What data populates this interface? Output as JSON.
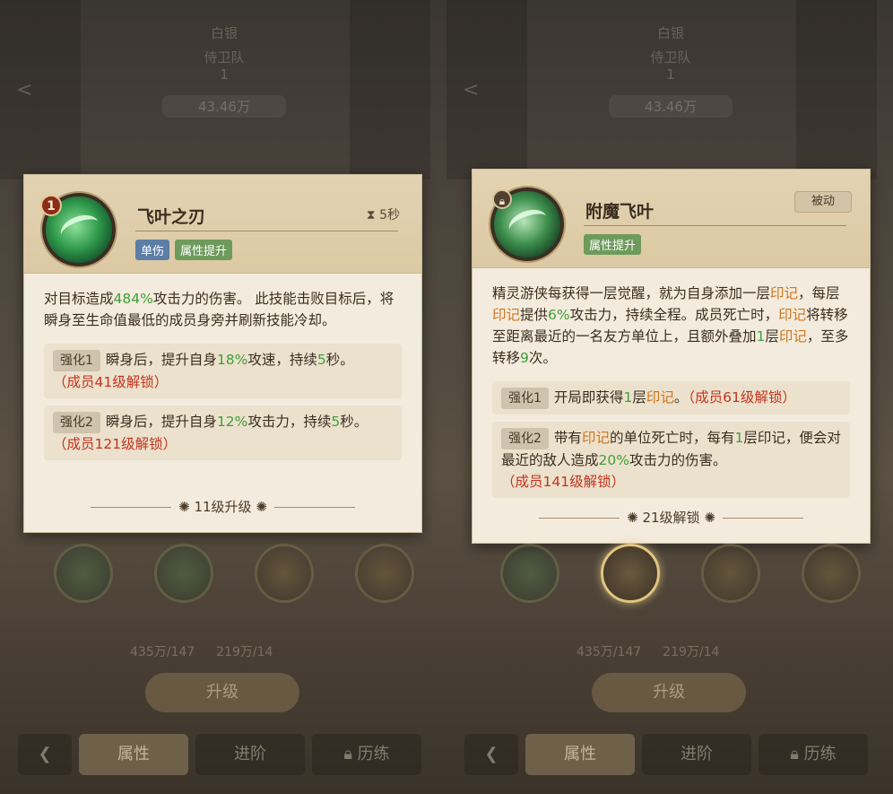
{
  "background": {
    "top_line1": "白银",
    "top_line2": "侍卫队",
    "top_line3": "1",
    "top_pill": "43.46万",
    "share_icon": "share-icon",
    "resource_gold": "435万/147",
    "resource_feather": "219万/14",
    "upgrade_button": "升级",
    "tabs": [
      "属性",
      "进阶",
      "历练"
    ]
  },
  "left_card": {
    "level": "1",
    "name": "飞叶之刃",
    "cooldown": "5秒",
    "tags": [
      "单伤",
      "属性提升"
    ],
    "desc_a": "对目标造成",
    "desc_pct": "484%",
    "desc_b": "攻击力的伤害。 此技能击败目标后，将瞬身至生命值最低的成员身旁并刷新技能冷却。",
    "enh1_tag": "强化1",
    "enh1_a": "瞬身后，提升自身",
    "enh1_pct": "18%",
    "enh1_b": "攻速，持续",
    "enh1_sec": "5",
    "enh1_c": "秒。",
    "enh1_unlock": "（成员41级解锁）",
    "enh2_tag": "强化2",
    "enh2_a": "瞬身后，提升自身",
    "enh2_pct": "12%",
    "enh2_b": "攻击力，持续",
    "enh2_sec": "5",
    "enh2_c": "秒。",
    "enh2_unlock": "（成员121级解锁）",
    "footer": "11级升级"
  },
  "right_card": {
    "name": "附魔飞叶",
    "passive": "被动",
    "tags": [
      "属性提升"
    ],
    "d1": "精灵游侠每获得一层觉醒，就为自身添加一层",
    "mark": "印记",
    "d2": "，每层",
    "d3": "提供",
    "pct6": "6%",
    "d4": "攻击力，持续全程。成员死亡时，",
    "d5": "将转移至距离最近的一名友方单位上，且额外叠加",
    "one": "1",
    "d6": "层",
    "d7": "，至多转移",
    "nine": "9",
    "d8": "次。",
    "enh1_tag": "强化1",
    "enh1_a": "开局即获得",
    "enh1_b": "层",
    "enh1_c": "。",
    "enh1_unlock": "（成员61级解锁）",
    "enh2_tag": "强化2",
    "enh2_a": "带有",
    "enh2_b": "的单位死亡时，每有",
    "enh2_c": "层印记，便会对最近的敌人造成",
    "pct20": "20%",
    "enh2_d": "攻击力的伤害。",
    "enh2_unlock": "（成员141级解锁）",
    "footer": "21级解锁"
  },
  "colors": {
    "highlight_green": "#3f9f3a",
    "highlight_orange": "#d0751b",
    "unlock_red": "#c2351f",
    "card_bg": "#f3ebdd"
  }
}
